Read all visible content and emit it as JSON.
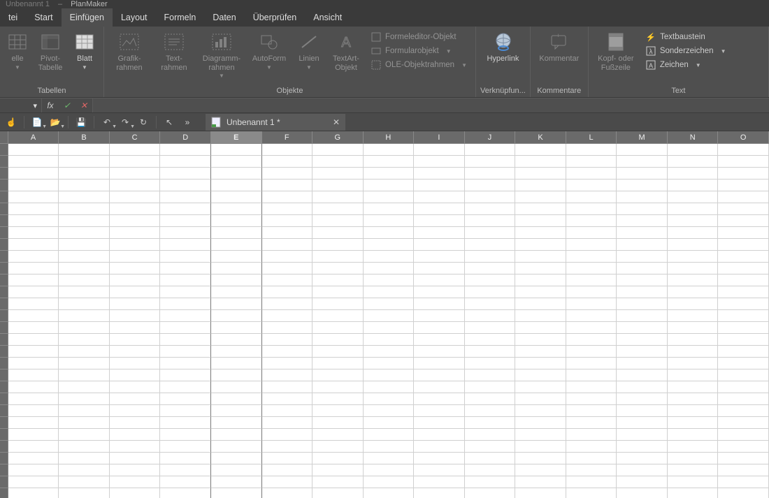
{
  "title": {
    "doc": "Unbenannt 1",
    "app": "PlanMaker"
  },
  "menus": [
    "tei",
    "Start",
    "Einfügen",
    "Layout",
    "Formeln",
    "Daten",
    "Überprüfen",
    "Ansicht"
  ],
  "active_menu": 2,
  "ribbon": {
    "groups": {
      "tabellen": {
        "label": "Tabellen",
        "btns": {
          "tabelle": "elle",
          "pivot": "Pivot-\nTabelle",
          "blatt": "Blatt"
        }
      },
      "objekte": {
        "label": "Objekte",
        "btns": {
          "grafik": "Grafik-\nrahmen",
          "text": "Text-\nrahmen",
          "diagramm": "Diagramm-\nrahmen",
          "autoform": "AutoForm",
          "linien": "Linien",
          "textart": "TextArt-\nObjekt"
        },
        "small": {
          "formeleditor": "Formeleditor-Objekt",
          "formular": "Formularobjekt",
          "ole": "OLE-Objektrahmen"
        }
      },
      "link": {
        "label": "Verknüpfun...",
        "btn": "Hyperlink"
      },
      "komm": {
        "label": "Kommentare",
        "btn": "Kommentar"
      },
      "text": {
        "label": "Text",
        "btn": "Kopf- oder\nFußzeile",
        "small": {
          "baustein": "Textbaustein",
          "sonder": "Sonderzeichen",
          "zeichen": "Zeichen"
        }
      }
    }
  },
  "fx": {
    "name_dd": "▾",
    "fx": "fx",
    "check": "✓",
    "cancel": "✕"
  },
  "doc_tab": {
    "label": "Unbenannt 1 *",
    "close": "✕"
  },
  "columns": [
    "A",
    "B",
    "C",
    "D",
    "E",
    "F",
    "G",
    "H",
    "I",
    "J",
    "K",
    "L",
    "M",
    "N",
    "O"
  ],
  "selected_col": "E",
  "row_count": 30
}
